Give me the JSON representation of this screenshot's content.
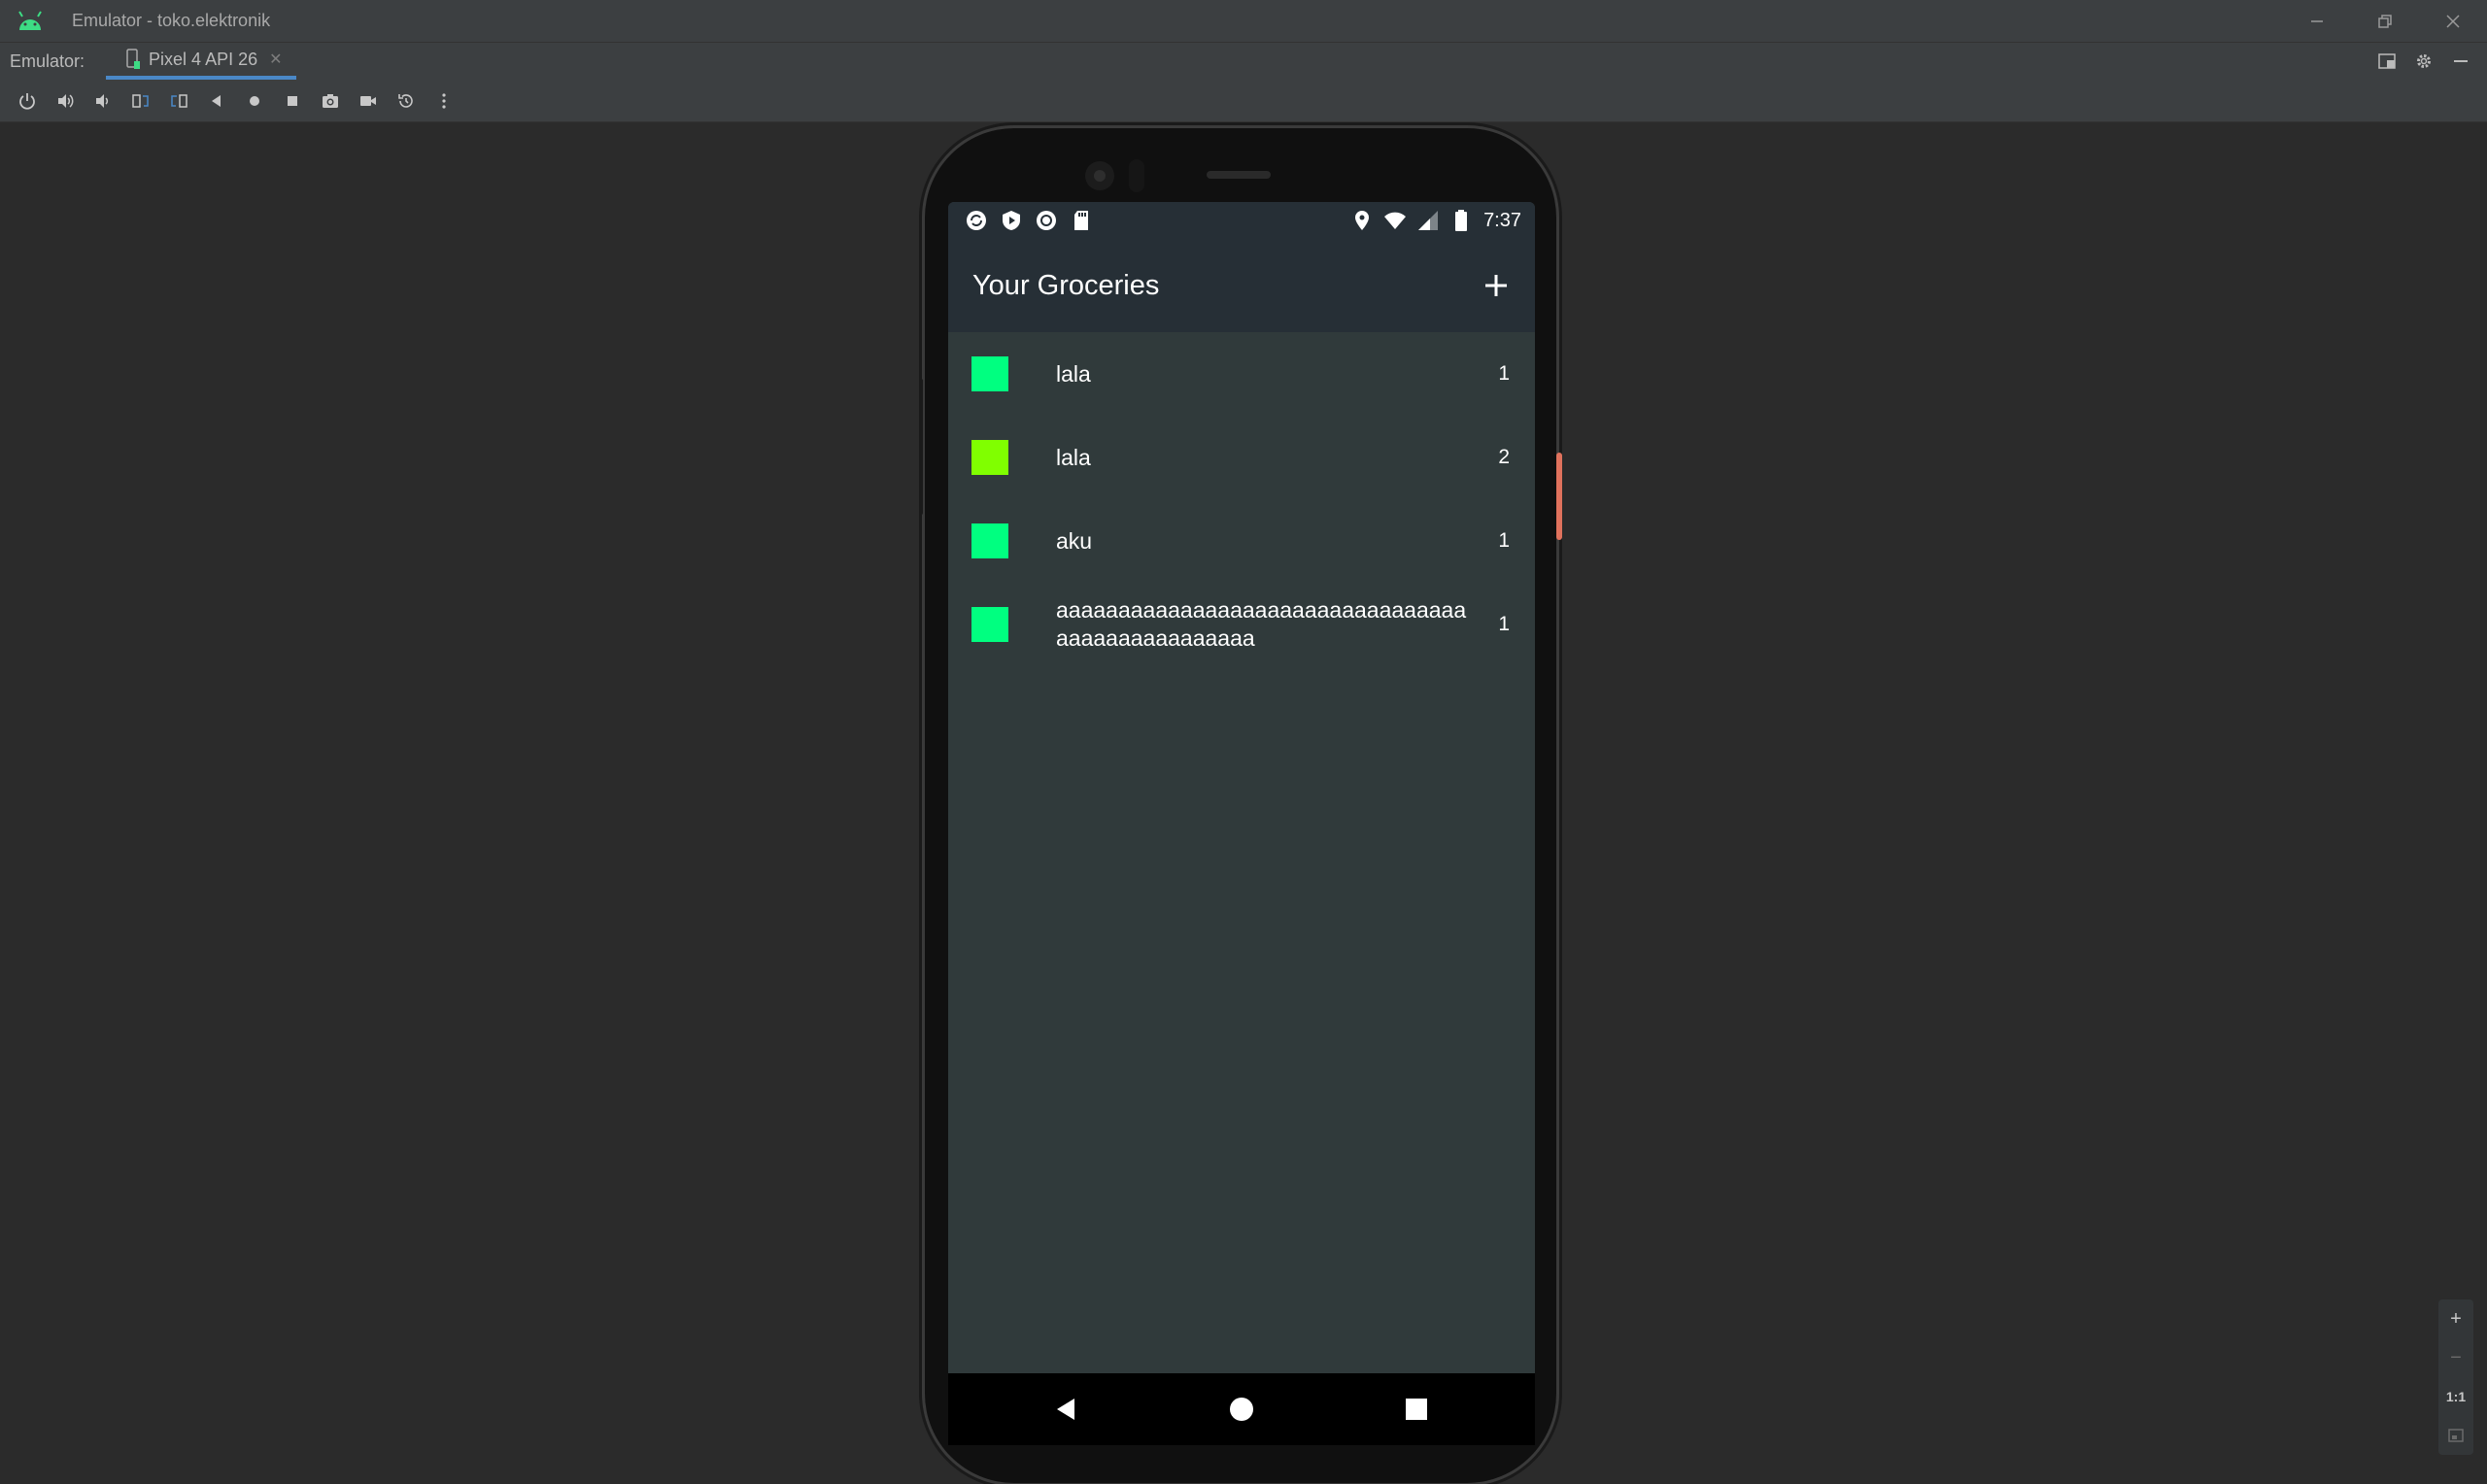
{
  "window": {
    "title": "Emulator - toko.elektronik"
  },
  "tabbar": {
    "label": "Emulator:",
    "tabs": [
      {
        "label": "Pixel 4 API 26"
      }
    ]
  },
  "statusbar": {
    "time": "7:37"
  },
  "app": {
    "title": "Your Groceries",
    "items": [
      {
        "name": "lala",
        "quantity": "1",
        "color": "#00ff80"
      },
      {
        "name": "lala",
        "quantity": "2",
        "color": "#80ff00"
      },
      {
        "name": "aku",
        "quantity": "1",
        "color": "#00ff80"
      },
      {
        "name": "aaaaaaaaaaaaaaaaaaaaaaaaaaaaaaaaaaaaaaaaaaaaaaaaa",
        "quantity": "1",
        "color": "#00ff80"
      }
    ]
  },
  "zoom": {
    "plus": "+",
    "minus": "−",
    "ratio": "1:1"
  },
  "colors": {
    "accent": "#4a88c7",
    "app_bar": "#262f36",
    "app_background": "#303a3b",
    "power_button": "#e0725d"
  }
}
